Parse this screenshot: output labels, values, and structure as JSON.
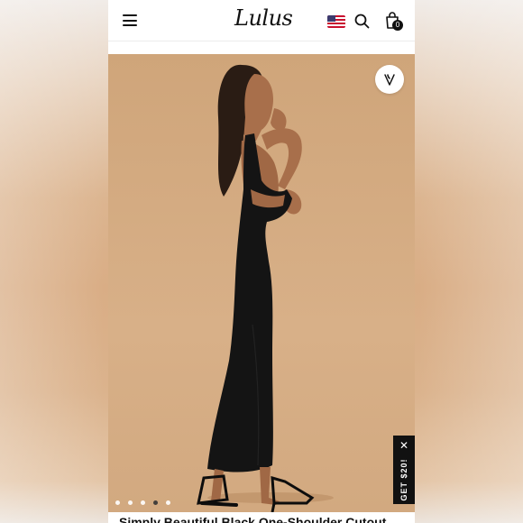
{
  "header": {
    "logo": "Lulus",
    "bag_count": "0"
  },
  "hero": {
    "slide_index": 4,
    "slide_total": 5
  },
  "promo": {
    "label": "GET $20!",
    "close": "✕"
  },
  "product": {
    "title": "Simply Beautiful Black One-Shoulder Cutout..."
  },
  "colors": {
    "brand": "#111111",
    "hero_bg": "#d5ab80",
    "dress": "#141414"
  },
  "icons": [
    "menu-icon",
    "us-flag-icon",
    "search-icon",
    "shopping-bag-icon",
    "heart-icon",
    "close-icon"
  ]
}
